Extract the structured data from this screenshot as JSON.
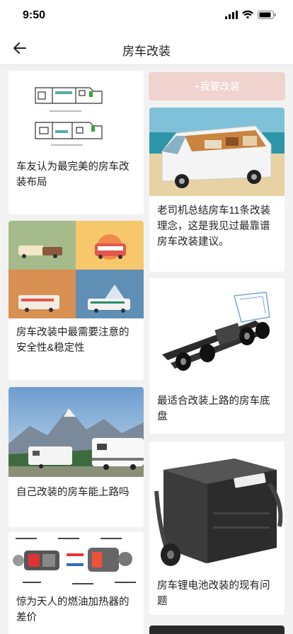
{
  "status": {
    "time": "9:50"
  },
  "nav": {
    "title": "房车改装"
  },
  "action": {
    "modify_label": "+我要改装"
  },
  "cards": [
    {
      "title": "车友认为最完美的房车改装布局"
    },
    {
      "title": "房车改装中最需要注意的安全性&稳定性"
    },
    {
      "title": "自己改装的房车能上路吗"
    },
    {
      "title": "惊为天人的燃油加热器的差价"
    },
    {
      "title": "老司机总结房车11条改装理念，这是我见过最靠谱房车改装建议。"
    },
    {
      "title": "最适合改装上路的房车底盘"
    },
    {
      "title": "房车锂电池改装的现有问题"
    }
  ],
  "colors": {
    "accent_button": "#f0d3cf",
    "background": "#f2f2f2"
  }
}
